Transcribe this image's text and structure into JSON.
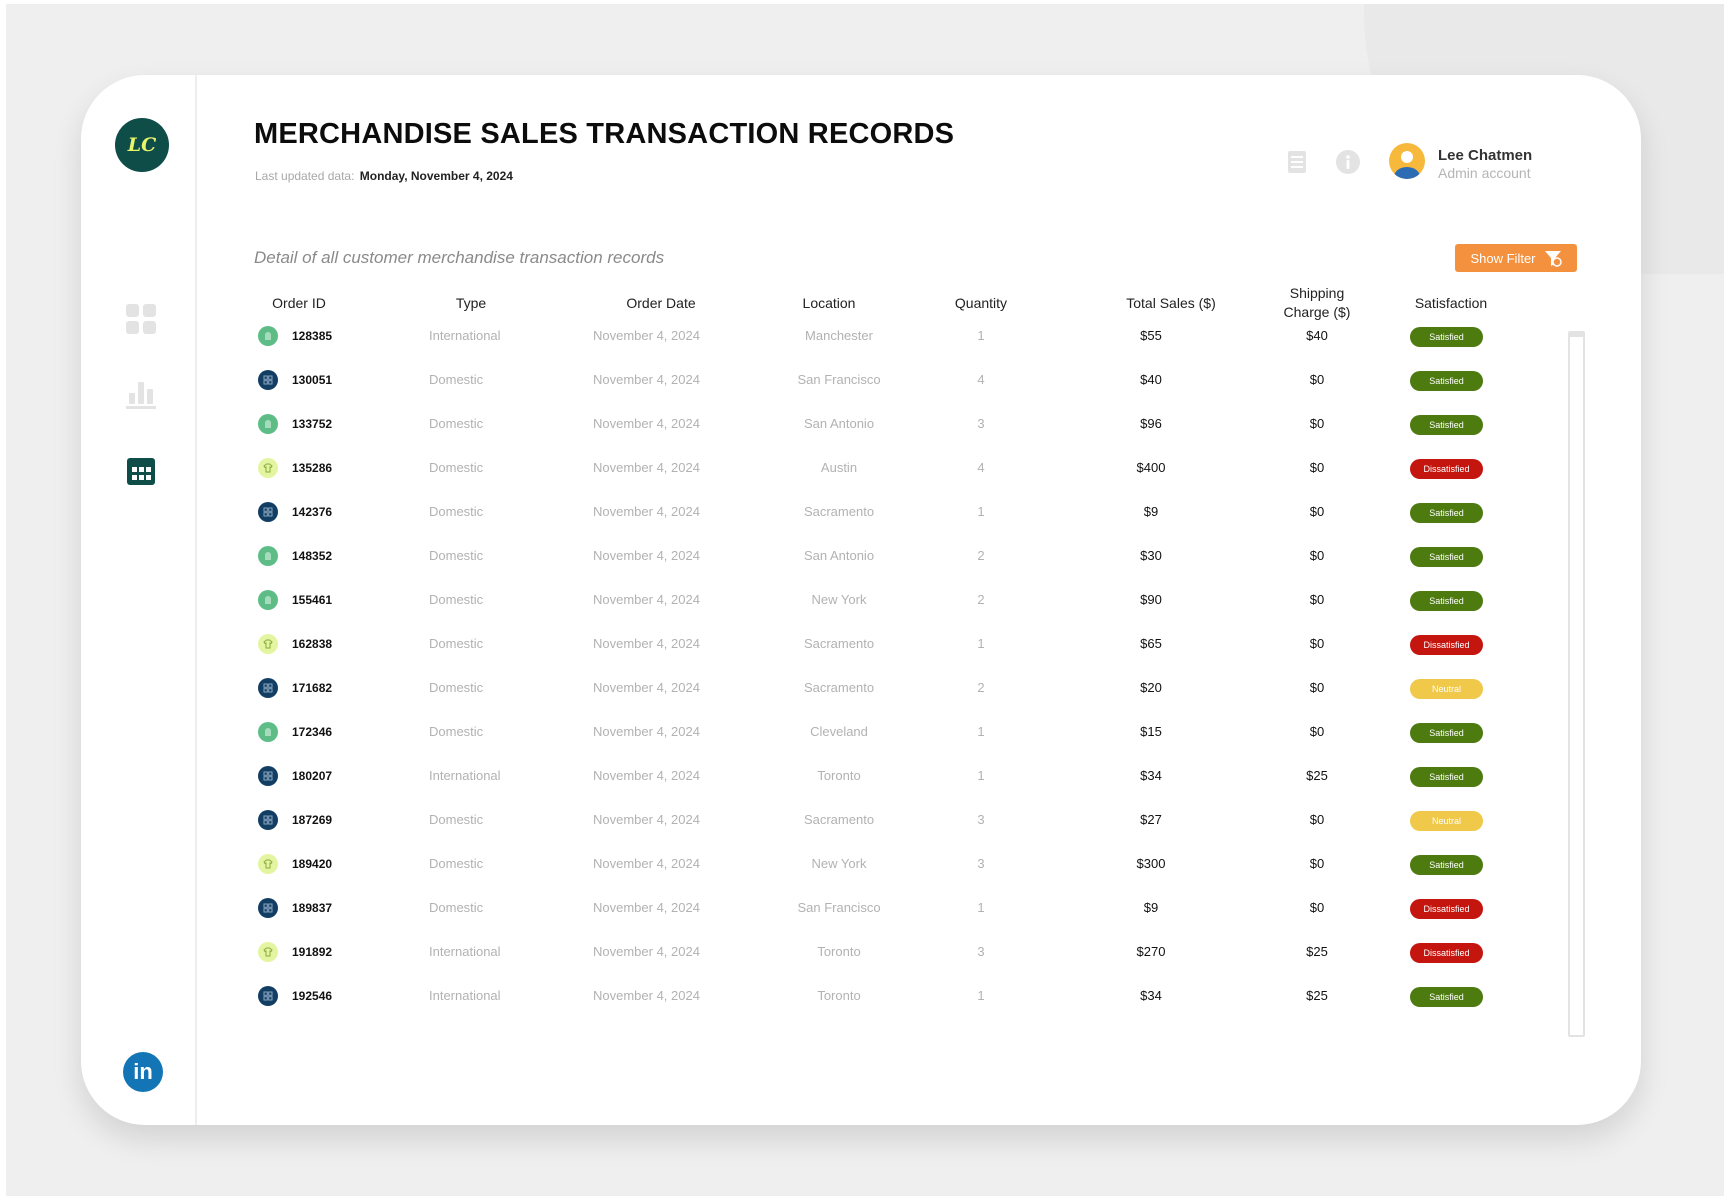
{
  "app": {
    "logo_text": "LC",
    "title": "MERCHANDISE SALES TRANSACTION RECORDS",
    "updated_label": "Last updated data:",
    "updated_value": "Monday, November 4, 2024",
    "subtitle": "Detail of all customer merchandise transaction records"
  },
  "sidebar": {
    "items": [
      {
        "icon": "dashboard-grid-icon",
        "active": false
      },
      {
        "icon": "bar-chart-icon",
        "active": false
      },
      {
        "icon": "calendar-table-icon",
        "active": true
      }
    ],
    "linkedin_label": "in"
  },
  "user": {
    "name": "Lee Chatmen",
    "role": "Admin account"
  },
  "toolbar": {
    "filter_label": "Show Filter"
  },
  "table": {
    "headers": {
      "order_id": "Order ID",
      "type": "Type",
      "order_date": "Order Date",
      "location": "Location",
      "quantity": "Quantity",
      "total_sales": "Total Sales ($)",
      "shipping_line1": "Shipping",
      "shipping_line2": "Charge ($)",
      "satisfaction": "Satisfaction"
    },
    "rows": [
      {
        "icon": "green",
        "id": "128385",
        "type": "International",
        "date": "November 4, 2024",
        "location": "Manchester",
        "qty": "1",
        "sales": "$55",
        "ship": "$40",
        "sat": "Satisfied"
      },
      {
        "icon": "navy",
        "id": "130051",
        "type": "Domestic",
        "date": "November 4, 2024",
        "location": "San Francisco",
        "qty": "4",
        "sales": "$40",
        "ship": "$0",
        "sat": "Satisfied"
      },
      {
        "icon": "green",
        "id": "133752",
        "type": "Domestic",
        "date": "November 4, 2024",
        "location": "San Antonio",
        "qty": "3",
        "sales": "$96",
        "ship": "$0",
        "sat": "Satisfied"
      },
      {
        "icon": "lime",
        "id": "135286",
        "type": "Domestic",
        "date": "November 4, 2024",
        "location": "Austin",
        "qty": "4",
        "sales": "$400",
        "ship": "$0",
        "sat": "Dissatisfied"
      },
      {
        "icon": "navy",
        "id": "142376",
        "type": "Domestic",
        "date": "November 4, 2024",
        "location": "Sacramento",
        "qty": "1",
        "sales": "$9",
        "ship": "$0",
        "sat": "Satisfied"
      },
      {
        "icon": "green",
        "id": "148352",
        "type": "Domestic",
        "date": "November 4, 2024",
        "location": "San Antonio",
        "qty": "2",
        "sales": "$30",
        "ship": "$0",
        "sat": "Satisfied"
      },
      {
        "icon": "green",
        "id": "155461",
        "type": "Domestic",
        "date": "November 4, 2024",
        "location": "New York",
        "qty": "2",
        "sales": "$90",
        "ship": "$0",
        "sat": "Satisfied"
      },
      {
        "icon": "lime",
        "id": "162838",
        "type": "Domestic",
        "date": "November 4, 2024",
        "location": "Sacramento",
        "qty": "1",
        "sales": "$65",
        "ship": "$0",
        "sat": "Dissatisfied"
      },
      {
        "icon": "navy",
        "id": "171682",
        "type": "Domestic",
        "date": "November 4, 2024",
        "location": "Sacramento",
        "qty": "2",
        "sales": "$20",
        "ship": "$0",
        "sat": "Neutral"
      },
      {
        "icon": "green",
        "id": "172346",
        "type": "Domestic",
        "date": "November 4, 2024",
        "location": "Cleveland",
        "qty": "1",
        "sales": "$15",
        "ship": "$0",
        "sat": "Satisfied"
      },
      {
        "icon": "navy",
        "id": "180207",
        "type": "International",
        "date": "November 4, 2024",
        "location": "Toronto",
        "qty": "1",
        "sales": "$34",
        "ship": "$25",
        "sat": "Satisfied"
      },
      {
        "icon": "navy",
        "id": "187269",
        "type": "Domestic",
        "date": "November 4, 2024",
        "location": "Sacramento",
        "qty": "3",
        "sales": "$27",
        "ship": "$0",
        "sat": "Neutral"
      },
      {
        "icon": "lime",
        "id": "189420",
        "type": "Domestic",
        "date": "November 4, 2024",
        "location": "New York",
        "qty": "3",
        "sales": "$300",
        "ship": "$0",
        "sat": "Satisfied"
      },
      {
        "icon": "navy",
        "id": "189837",
        "type": "Domestic",
        "date": "November 4, 2024",
        "location": "San Francisco",
        "qty": "1",
        "sales": "$9",
        "ship": "$0",
        "sat": "Dissatisfied"
      },
      {
        "icon": "lime",
        "id": "191892",
        "type": "International",
        "date": "November 4, 2024",
        "location": "Toronto",
        "qty": "3",
        "sales": "$270",
        "ship": "$25",
        "sat": "Dissatisfied"
      },
      {
        "icon": "navy",
        "id": "192546",
        "type": "International",
        "date": "November 4, 2024",
        "location": "Toronto",
        "qty": "1",
        "sales": "$34",
        "ship": "$25",
        "sat": "Satisfied"
      }
    ]
  },
  "colors": {
    "accent": "#f4913f",
    "logo_bg": "#0f4d49",
    "satisfied": "#4d7b0f",
    "dissatisfied": "#c4150f",
    "neutral": "#f0c84a",
    "icon_green": "#5ebd87",
    "icon_navy": "#133e63",
    "icon_lime": "#e4f5a2"
  }
}
